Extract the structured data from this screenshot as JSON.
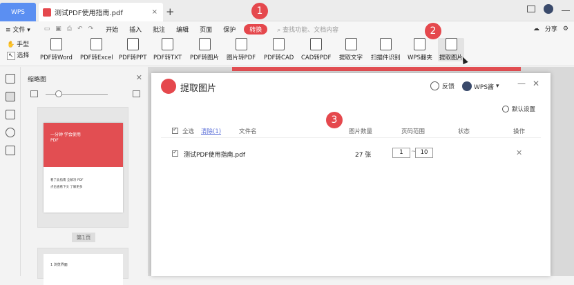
{
  "titlebar": {
    "app_tab": "WPS",
    "doc_tab": "测试PDF使用指南.pdf",
    "close_glyph": "×",
    "add_glyph": "+"
  },
  "menubar": {
    "file": "≡ 文件 ▾",
    "items": [
      "开始",
      "插入",
      "批注",
      "编辑",
      "页面",
      "保护"
    ],
    "active": "转换",
    "search": "查找功能、文档内容",
    "share": "分享"
  },
  "toolbar": {
    "hand": "手型",
    "select": "选择",
    "tools": [
      "PDF转Word",
      "PDF转Excel",
      "PDF转PPT",
      "PDF转TXT",
      "PDF转图片",
      "图片转PDF",
      "PDF转CAD",
      "CAD转PDF",
      "提取文字",
      "扫描件识别",
      "WPS翻夹",
      "提取图片"
    ]
  },
  "thumbnails": {
    "title": "缩略图",
    "page1_title": "一分钟 学会使用\nPDF",
    "page1_line1": "看了此指南 全解决 PDF",
    "page1_line2": "点击查看下文 了解更多",
    "page_label": "第1页",
    "page2_text": "1 浏览界面"
  },
  "dialog": {
    "title": "提取图片",
    "feedback": "反馈",
    "user": "WPS酱",
    "settings": "默认设置",
    "header": {
      "select_all": "全选",
      "clear": "清除(1)",
      "filename": "文件名",
      "img_count": "图片数量",
      "page_range": "页码范围",
      "status": "状态",
      "action": "操作"
    },
    "row": {
      "filename": "测试PDF使用指南.pdf",
      "count": "27 张",
      "from": "1",
      "dash": "~",
      "to": "10"
    }
  },
  "annotations": [
    "1",
    "2",
    "3"
  ],
  "colors": {
    "accent": "#e5484d",
    "wps_blue": "#5b8ff2"
  }
}
